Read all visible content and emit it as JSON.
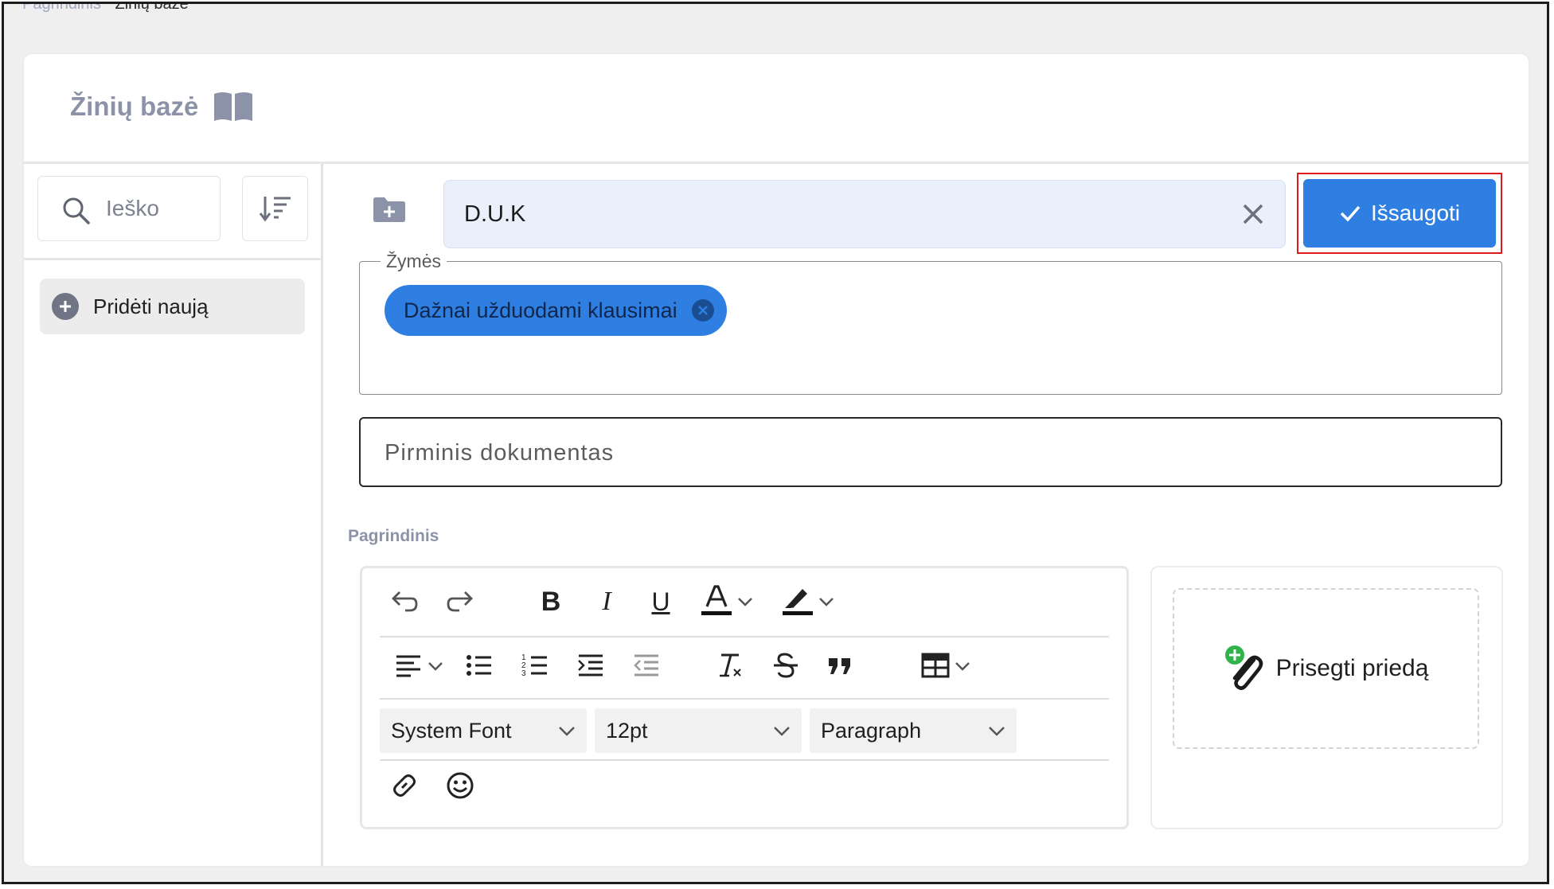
{
  "breadcrumb": {
    "parent": "Pagrindinis",
    "current": "Žinių bazė"
  },
  "page": {
    "title": "Žinių bazė",
    "icon": "book-open-icon"
  },
  "sidebar": {
    "search_placeholder": "Ieško",
    "sort_icon": "sort-desc-icon",
    "add_new_label": "Pridėti naują"
  },
  "form": {
    "title_value": "D.U.K",
    "save_label": "Išsaugoti",
    "tags_legend": "Žymės",
    "tags": [
      "Dažnai užduodami klausimai"
    ],
    "primary_document_placeholder": "Pirminis dokumentas",
    "section_label": "Pagrindinis"
  },
  "editor": {
    "font_family": "System Font",
    "font_size": "12pt",
    "block_format": "Paragraph"
  },
  "attachment": {
    "label": "Prisegti priedą"
  },
  "colors": {
    "accent": "#2f7fe3",
    "highlight_border": "#e01a1a",
    "muted_heading": "#8c93a8"
  }
}
